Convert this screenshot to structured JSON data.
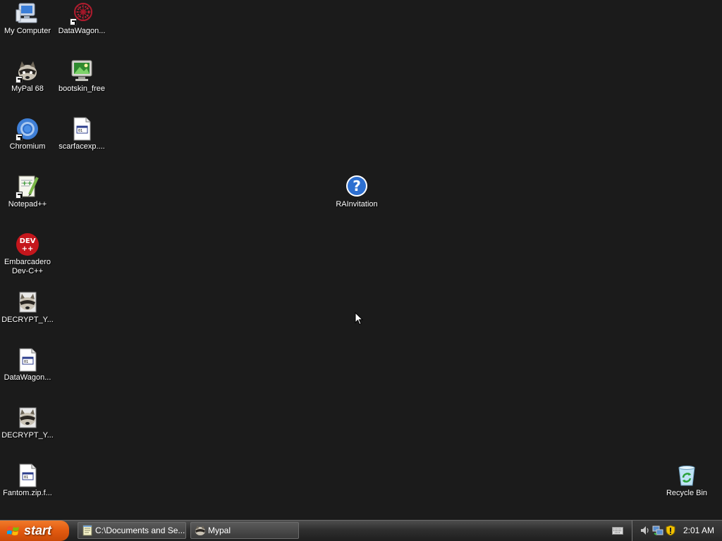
{
  "desktop": {
    "icons": [
      {
        "label": "My Computer"
      },
      {
        "label": "DataWagon..."
      },
      {
        "label": "MyPal 68"
      },
      {
        "label": "bootskin_free"
      },
      {
        "label": "Chromium"
      },
      {
        "label": "scarfacexp...."
      },
      {
        "label": "Notepad++"
      },
      {
        "label": "RAInvitation"
      },
      {
        "label": "Embarcadero Dev-C++"
      },
      {
        "label": "DECRYPT_Y..."
      },
      {
        "label": "DataWagon..."
      },
      {
        "label": "DECRYPT_Y..."
      },
      {
        "label": "Fantom.zip.f..."
      },
      {
        "label": "Recycle Bin"
      }
    ]
  },
  "taskbar": {
    "start_label": "start",
    "tasks": [
      {
        "label": "C:\\Documents and Se...",
        "icon": "notepad-icon"
      },
      {
        "label": "Mypal",
        "icon": "mypal-icon"
      }
    ],
    "clock": "2:01 AM"
  },
  "colors": {
    "desktop_background": "#1b1b1b",
    "start_button": "#e25a10",
    "taskbar": "#2f2f2f"
  }
}
